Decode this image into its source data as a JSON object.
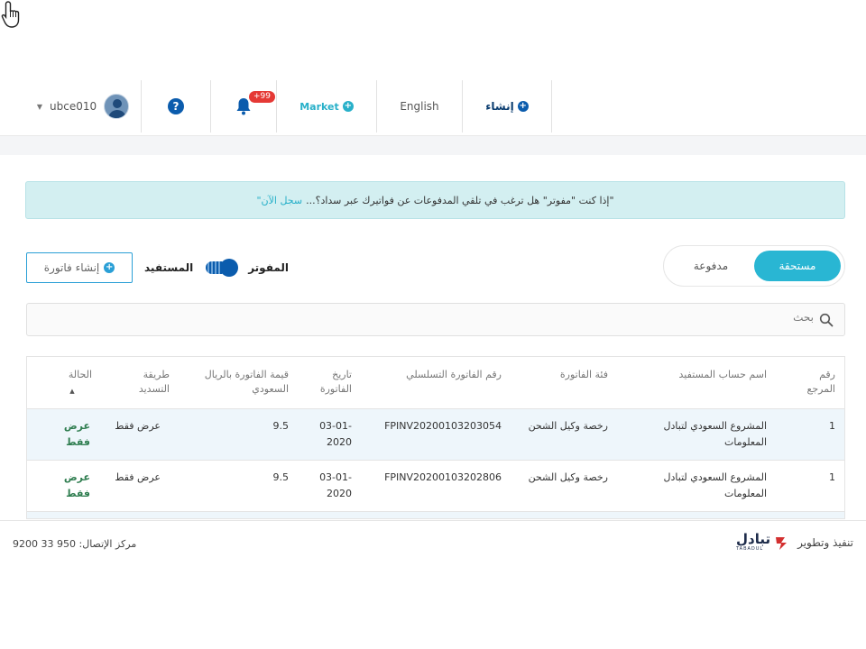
{
  "nav": {
    "username": "ubce010",
    "help": "?",
    "notification_badge": "+99",
    "market": "Market",
    "language": "English",
    "create": "إنشاء"
  },
  "banner": {
    "text": "\"إذا كنت \"مفوتر\" هل ترغب في تلقي المدفوعات عن فواتيرك عبر سداد؟...",
    "link": "سجل الآن\""
  },
  "tabs": {
    "due": "مستحقة",
    "paid": "مدفوعة"
  },
  "toggle": {
    "biller": "المفوتر",
    "beneficiary": "المستفيد"
  },
  "create_invoice": "إنشاء فاتورة",
  "search": {
    "placeholder": "بحث"
  },
  "table": {
    "headers": {
      "ref": "رقم المرجع",
      "account": "اسم حساب المستفيد",
      "category": "فئة الفاتورة",
      "serial": "رقم الفاتورة التسلسلي",
      "date": "تاريخ الفاتورة",
      "amount": "قيمة الفاتورة بالريال السعودي",
      "method": "طريقة التسديد",
      "status": "الحالة"
    },
    "rows": [
      {
        "ref": "1",
        "account": "المشروع السعودي لتبادل المعلومات",
        "category": "رخصة وكيل الشحن",
        "serial": "FPINV20200103203054",
        "date": "03-01-2020",
        "amount": "9.5",
        "method": "عرض فقط",
        "status": "عرض فقط"
      },
      {
        "ref": "1",
        "account": "المشروع السعودي لتبادل المعلومات",
        "category": "رخصة وكيل الشحن",
        "serial": "FPINV20200103202806",
        "date": "03-01-2020",
        "amount": "9.5",
        "method": "عرض فقط",
        "status": "عرض فقط"
      }
    ]
  },
  "footer": {
    "contact": "مركز الإتصال: 950 33 9200",
    "developed_by": "تنفيذ وتطوير",
    "logo_text": "تبادل",
    "logo_sub": "TABADUL"
  },
  "colors": {
    "accent": "#29b6d3",
    "primary": "#0b5cad",
    "banner_bg": "#d3eff1",
    "status_green": "#2e7d4f",
    "badge_red": "#e53935"
  }
}
